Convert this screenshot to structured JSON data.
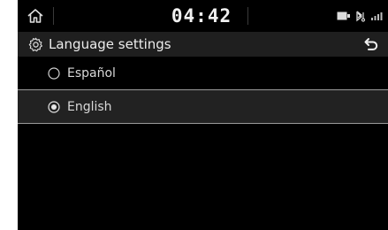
{
  "status_bar": {
    "time": "04:42",
    "icons": [
      "media-icon",
      "bluetooth-audio-icon",
      "signal-icon"
    ]
  },
  "header": {
    "title": "Language settings",
    "icon": "gear-icon",
    "back_icon": "back-arrow-icon"
  },
  "languages": {
    "items": [
      {
        "label": "Español",
        "selected": false
      },
      {
        "label": "English",
        "selected": true
      }
    ]
  },
  "colors": {
    "background": "#000000",
    "header_bg": "#1f1f1f",
    "selected_bg": "#222222",
    "text": "#e6e6e6",
    "divider": "#9a9a9a"
  }
}
